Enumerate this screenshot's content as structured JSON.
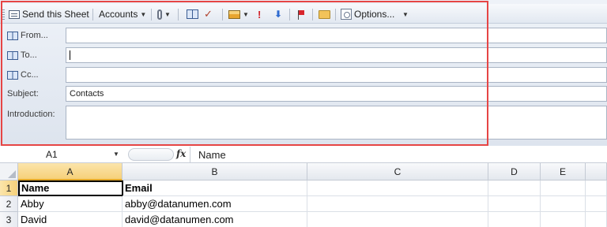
{
  "toolbar": {
    "send_label": "Send this Sheet",
    "accounts_label": "Accounts",
    "options_label": "Options...",
    "icons": [
      "sheet-icon",
      "attach-icon",
      "address-book-icon",
      "check-names-icon",
      "card-icon",
      "high-importance-icon",
      "low-importance-icon",
      "follow-up-flag-icon",
      "folder-icon",
      "options-icon"
    ]
  },
  "envelope": {
    "from_label": "From...",
    "to_label": "To...",
    "cc_label": "Cc...",
    "subject_label": "Subject:",
    "introduction_label": "Introduction:",
    "from_value": "",
    "to_value": "",
    "cc_value": "",
    "subject_value": "Contacts",
    "introduction_value": ""
  },
  "highlight_color": "#e64545",
  "formula_bar": {
    "name_box": "A1",
    "fx": "fx",
    "content": "Name"
  },
  "sheet": {
    "columns": [
      "A",
      "B",
      "C",
      "D",
      "E"
    ],
    "rows": [
      {
        "num": "1",
        "cells": [
          "Name",
          "Email"
        ]
      },
      {
        "num": "2",
        "cells": [
          "Abby",
          "abby@datanumen.com"
        ]
      },
      {
        "num": "3",
        "cells": [
          "David",
          "david@datanumen.com"
        ]
      }
    ]
  }
}
